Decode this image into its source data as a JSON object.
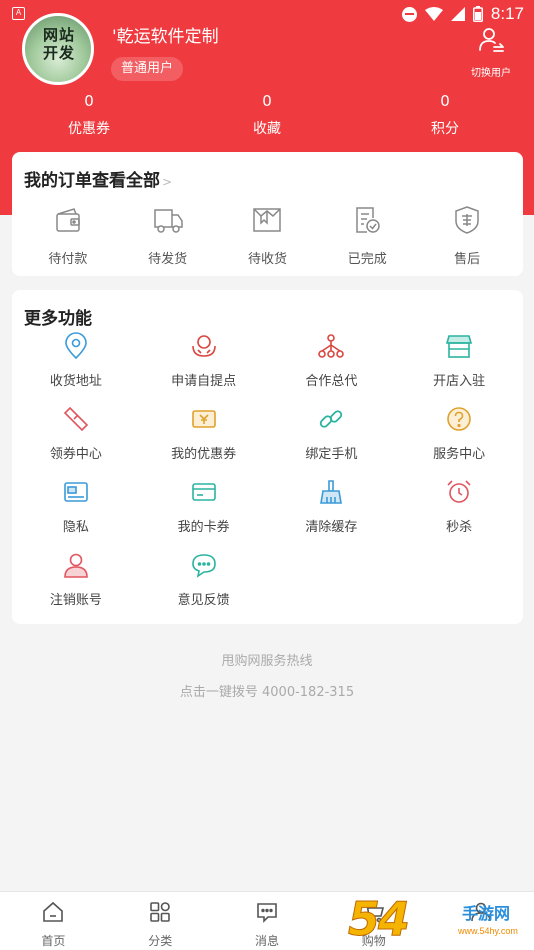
{
  "status_bar": {
    "time": "8:17",
    "app_badge": "A"
  },
  "profile": {
    "avatar_text_line1": "网站",
    "avatar_text_line2": "开发",
    "username": "'乾运软件定制",
    "user_level": "普通用户",
    "switch_user_label": "切换用户"
  },
  "stats": [
    {
      "value": "0",
      "label": "优惠券"
    },
    {
      "value": "0",
      "label": "收藏"
    },
    {
      "value": "0",
      "label": "积分"
    }
  ],
  "orders": {
    "title": "我的订单查看全部",
    "more_glyph": ">",
    "items": [
      {
        "label": "待付款",
        "icon": "wallet-icon"
      },
      {
        "label": "待发货",
        "icon": "truck-icon"
      },
      {
        "label": "待收货",
        "icon": "package-icon"
      },
      {
        "label": "已完成",
        "icon": "completed-doc-icon"
      },
      {
        "label": "售后",
        "icon": "after-sales-shield-icon"
      }
    ]
  },
  "more_functions": {
    "title": "更多功能",
    "items": [
      {
        "label": "收货地址",
        "icon": "location-pin-icon",
        "color": "#3a9bd9"
      },
      {
        "label": "申请自提点",
        "icon": "hands-icon",
        "color": "#d9473f"
      },
      {
        "label": "合作总代",
        "icon": "network-icon",
        "color": "#d9473f"
      },
      {
        "label": "开店入驻",
        "icon": "store-icon",
        "color": "#2bb3a0"
      },
      {
        "label": "领券中心",
        "icon": "ticket-icon",
        "color": "#e0565f"
      },
      {
        "label": "我的优惠券",
        "icon": "yen-coupon-icon",
        "color": "#e0a12c"
      },
      {
        "label": "绑定手机",
        "icon": "link-icon",
        "color": "#2bb3a0"
      },
      {
        "label": "服务中心",
        "icon": "question-icon",
        "color": "#e0a12c"
      },
      {
        "label": "隐私",
        "icon": "privacy-card-icon",
        "color": "#3a9bd9"
      },
      {
        "label": "我的卡券",
        "icon": "card-icon",
        "color": "#2bb3a0"
      },
      {
        "label": "清除缓存",
        "icon": "broom-icon",
        "color": "#3a9bd9"
      },
      {
        "label": "秒杀",
        "icon": "alarm-clock-icon",
        "color": "#e0565f"
      },
      {
        "label": "注销账号",
        "icon": "user-icon",
        "color": "#e0565f"
      },
      {
        "label": "意见反馈",
        "icon": "chat-bubble-icon",
        "color": "#2bb3a0"
      }
    ]
  },
  "footer": {
    "hotline": "甩购网服务热线",
    "dial": "点击一键拨号 4000-182-315"
  },
  "bottom_nav": [
    {
      "label": "首页",
      "icon": "home-icon"
    },
    {
      "label": "分类",
      "icon": "category-grid-icon"
    },
    {
      "label": "消息",
      "icon": "message-icon"
    },
    {
      "label": "购物",
      "icon": "cart-icon"
    },
    {
      "label": "",
      "icon": "user-nav-icon"
    }
  ],
  "watermark": {
    "number": "54",
    "text": "手游网",
    "url": "www.54hy.com"
  },
  "colors": {
    "brand_red": "#ef3b3f"
  }
}
